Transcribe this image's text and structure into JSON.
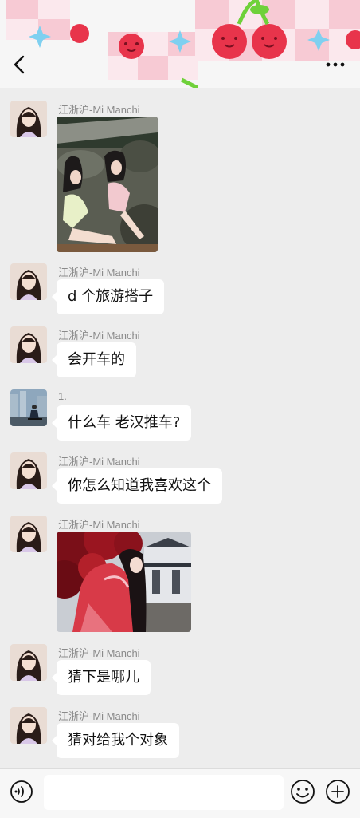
{
  "header": {
    "back_icon": "chevron-left-icon",
    "more_icon": "more-dots-icon",
    "decoration": "pink-gingham-cherry-banner"
  },
  "messages": [
    {
      "sender": "江浙沪-Mi Manchi",
      "type": "image",
      "image_desc": "two-girls-sitting-on-rocks-photo",
      "avatar": "girl-avatar"
    },
    {
      "sender": "江浙沪-Mi Manchi",
      "type": "text",
      "text": "d 个旅游搭子",
      "avatar": "girl-avatar"
    },
    {
      "sender": "江浙沪-Mi Manchi",
      "type": "text",
      "text": "会开车的",
      "avatar": "girl-avatar"
    },
    {
      "sender": "1.",
      "type": "text",
      "text": "什么车  老汉推车?",
      "avatar": "city-man-avatar"
    },
    {
      "sender": "江浙沪-Mi Manchi",
      "type": "text",
      "text": "你怎么知道我喜欢这个",
      "avatar": "girl-avatar"
    },
    {
      "sender": "江浙沪-Mi Manchi",
      "type": "image",
      "image_desc": "girl-in-red-hanfu-under-maple-photo",
      "avatar": "girl-avatar"
    },
    {
      "sender": "江浙沪-Mi Manchi",
      "type": "text",
      "text": "猜下是哪儿",
      "avatar": "girl-avatar"
    },
    {
      "sender": "江浙沪-Mi Manchi",
      "type": "text",
      "text": "猜对给我个对象",
      "avatar": "girl-avatar"
    }
  ],
  "input_bar": {
    "voice_icon": "voice-icon",
    "emoji_icon": "emoji-icon",
    "plus_icon": "plus-icon",
    "input_value": ""
  },
  "colors": {
    "background": "#ededed",
    "bubble": "#ffffff",
    "sender_text": "#8a8a8a",
    "header_pink": "#f7a8b8",
    "cherry_red": "#e8344b",
    "leaf_green": "#6fd13a",
    "sparkle_blue": "#7fd0f0"
  }
}
